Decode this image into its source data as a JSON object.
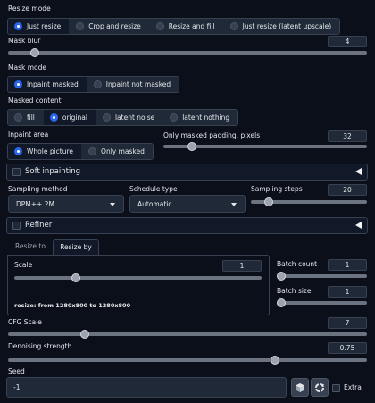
{
  "resize_mode": {
    "label": "Resize mode",
    "options": [
      "Just resize",
      "Crop and resize",
      "Resize and fill",
      "Just resize (latent upscale)"
    ],
    "selected": "Just resize"
  },
  "mask_blur": {
    "label": "Mask blur",
    "value": "4",
    "min": 0,
    "max": 64,
    "current": 4
  },
  "mask_mode": {
    "label": "Mask mode",
    "options": [
      "Inpaint masked",
      "Inpaint not masked"
    ],
    "selected": "Inpaint masked"
  },
  "masked_content": {
    "label": "Masked content",
    "options": [
      "fill",
      "original",
      "latent noise",
      "latent nothing"
    ],
    "selected": "original"
  },
  "inpaint_area": {
    "label": "Inpaint area",
    "options": [
      "Whole picture",
      "Only masked"
    ],
    "selected": "Whole picture"
  },
  "only_masked_padding": {
    "label": "Only masked padding, pixels",
    "value": "32",
    "min": 0,
    "max": 256,
    "current": 32
  },
  "soft_inpainting": {
    "label": "Soft inpainting",
    "checked": false
  },
  "sampling_method": {
    "label": "Sampling method",
    "value": "DPM++ 2M"
  },
  "schedule_type": {
    "label": "Schedule type",
    "value": "Automatic"
  },
  "sampling_steps": {
    "label": "Sampling steps",
    "value": "20",
    "min": 1,
    "max": 150,
    "current": 20
  },
  "refiner": {
    "label": "Refiner",
    "checked": false
  },
  "resize_tabs": {
    "tabs": [
      "Resize to",
      "Resize by"
    ],
    "active": "Resize by"
  },
  "scale": {
    "label": "Scale",
    "value": "1",
    "min": 0.05,
    "max": 4,
    "current": 1
  },
  "batch_count": {
    "label": "Batch count",
    "value": "1",
    "min": 1,
    "max": 100,
    "current": 1
  },
  "batch_size": {
    "label": "Batch size",
    "value": "1",
    "min": 1,
    "max": 8,
    "current": 1
  },
  "resize_info": "resize: from 1280x800 to 1280x800",
  "cfg_scale": {
    "label": "CFG Scale",
    "value": "7",
    "min": 1,
    "max": 30,
    "current": 7
  },
  "denoising_strength": {
    "label": "Denoising strength",
    "value": "0.75",
    "min": 0,
    "max": 1,
    "current": 0.75
  },
  "seed": {
    "label": "Seed",
    "value": "-1"
  },
  "extra": {
    "label": "Extra",
    "checked": false
  },
  "icons": {
    "dice": "dice-icon",
    "recycle": "recycle-icon",
    "expand": "triangle-left-icon",
    "caret": "chevron-down-icon"
  },
  "colors": {
    "background": "#0b0f19",
    "accent": "#2563eb",
    "panel": "#1f2937"
  }
}
